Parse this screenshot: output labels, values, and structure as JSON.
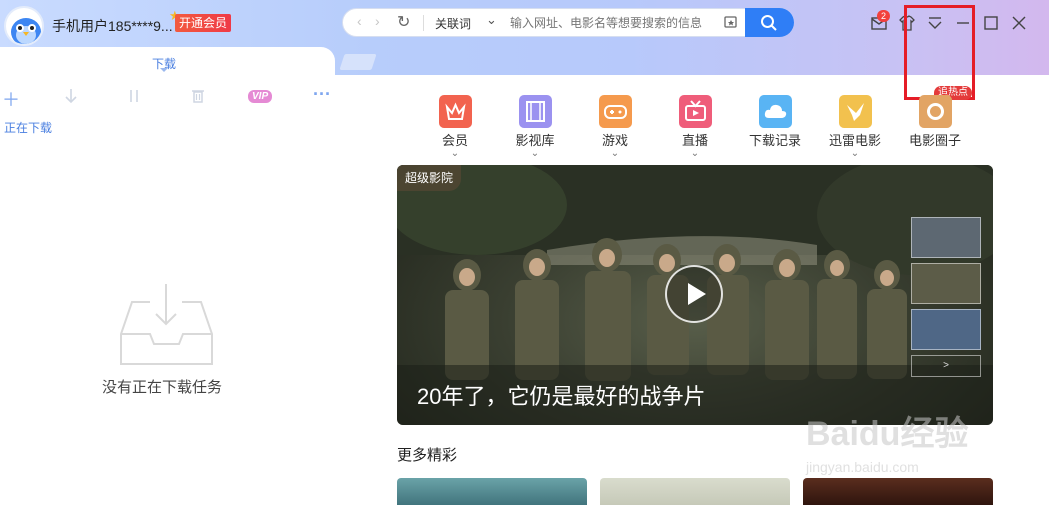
{
  "user": {
    "name": "手机用户185****9...",
    "vip_button": "开通会员"
  },
  "address_bar": {
    "keyword_mode": "关联词",
    "placeholder": "输入网址、电影名等想要搜索的信息"
  },
  "notifications": {
    "count": "2"
  },
  "promo_label": "追热点",
  "left_panel": {
    "tab_label": "下载",
    "toolbar": {
      "vip": "VIP"
    },
    "status_label": "正在下载",
    "empty_text": "没有正在下载任务"
  },
  "categories": [
    {
      "label": "会员",
      "icon": "crown-icon",
      "color": "#f2634f"
    },
    {
      "label": "影视库",
      "icon": "film-icon",
      "color": "#9b92f0"
    },
    {
      "label": "游戏",
      "icon": "gamepad-icon",
      "color": "#f59a4d"
    },
    {
      "label": "直播",
      "icon": "tv-icon",
      "color": "#ef5d7a"
    },
    {
      "label": "下载记录",
      "icon": "cloud-icon",
      "color": "#59b4f4"
    },
    {
      "label": "迅雷电影",
      "icon": "bird-icon",
      "color": "#f2c14e"
    },
    {
      "label": "电影圈子",
      "icon": "circle-icon",
      "color": "#e2a464"
    }
  ],
  "banner": {
    "tag": "超级影院",
    "title": "20年了，它仍是最好的战争片",
    "next_label": ">"
  },
  "more_section": {
    "title": "更多精彩"
  },
  "watermark": {
    "text": "Baidu经验",
    "url": "jingyan.baidu.com"
  }
}
